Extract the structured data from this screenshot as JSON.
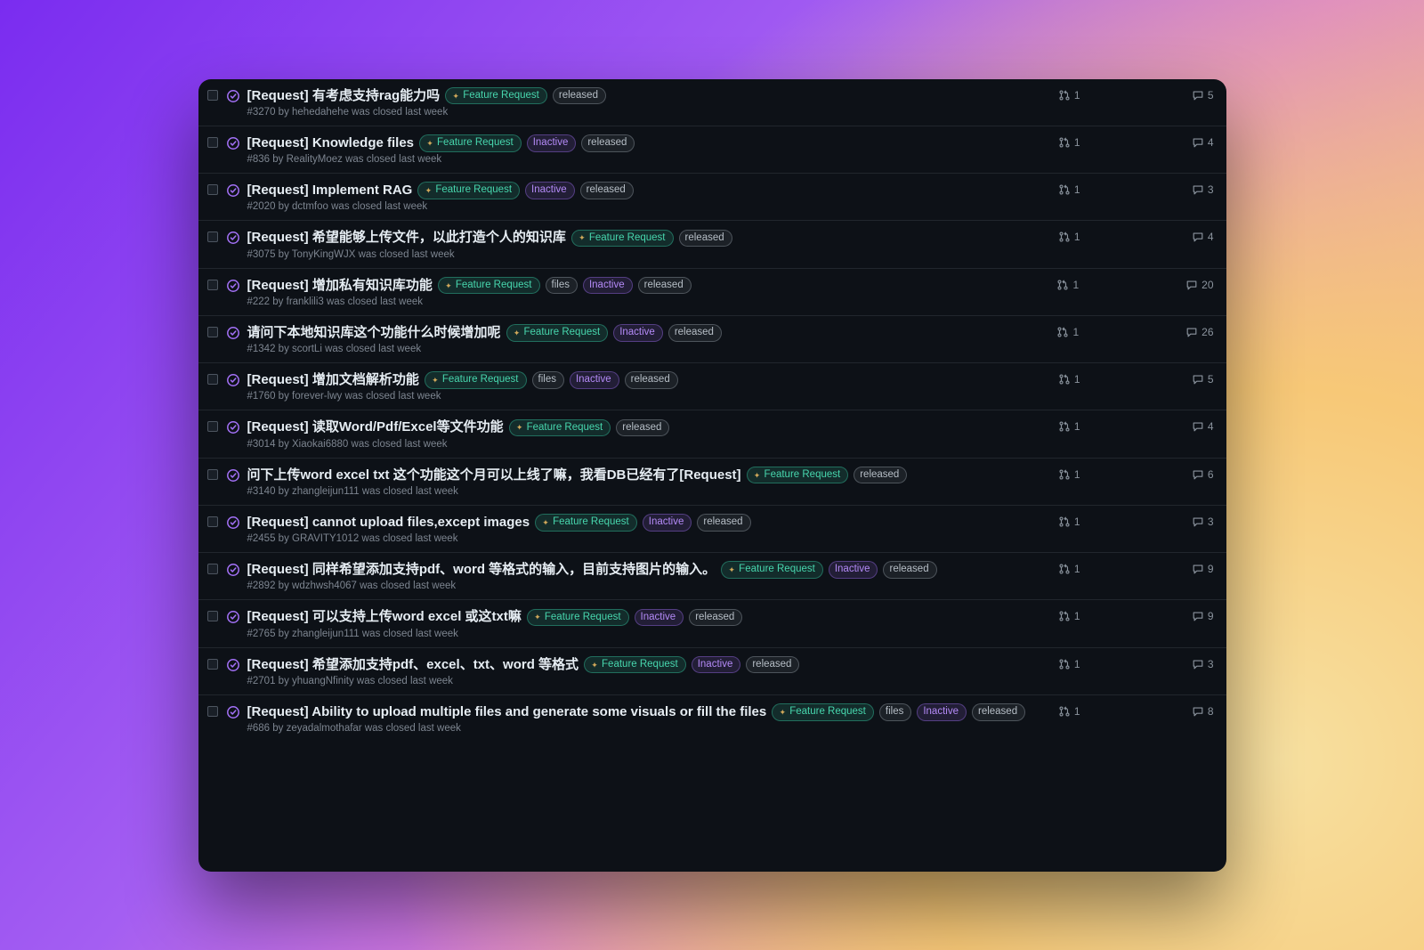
{
  "labels": {
    "feature": "Feature Request",
    "inactive": "Inactive",
    "released": "released",
    "files": "files"
  },
  "issues": [
    {
      "title": "[Request] 有考虑支持rag能力吗",
      "tags": [
        "feature",
        "released"
      ],
      "meta": "#3270 by hehedahehe was closed last week",
      "prs": 1,
      "comments": 5
    },
    {
      "title": "[Request] Knowledge files",
      "tags": [
        "feature",
        "inactive",
        "released"
      ],
      "meta": "#836 by RealityMoez was closed last week",
      "prs": 1,
      "comments": 4
    },
    {
      "title": "[Request] Implement RAG",
      "tags": [
        "feature",
        "inactive",
        "released"
      ],
      "meta": "#2020 by dctmfoo was closed last week",
      "prs": 1,
      "comments": 3
    },
    {
      "title": "[Request] 希望能够上传文件，以此打造个人的知识库",
      "tags": [
        "feature",
        "released"
      ],
      "meta": "#3075 by TonyKingWJX was closed last week",
      "prs": 1,
      "comments": 4
    },
    {
      "title": "[Request] 增加私有知识库功能",
      "tags": [
        "feature",
        "files",
        "inactive",
        "released"
      ],
      "meta": "#222 by franklili3 was closed last week",
      "prs": 1,
      "comments": 20
    },
    {
      "title": "请问下本地知识库这个功能什么时候增加呢",
      "tags": [
        "feature",
        "inactive",
        "released"
      ],
      "meta": "#1342 by scortLi was closed last week",
      "prs": 1,
      "comments": 26
    },
    {
      "title": "[Request] 增加文档解析功能",
      "tags": [
        "feature",
        "files",
        "inactive",
        "released"
      ],
      "meta": "#1760 by forever-lwy was closed last week",
      "prs": 1,
      "comments": 5
    },
    {
      "title": "[Request] 读取Word/Pdf/Excel等文件功能",
      "tags": [
        "feature",
        "released"
      ],
      "meta": "#3014 by Xiaokai6880 was closed last week",
      "prs": 1,
      "comments": 4
    },
    {
      "title": "问下上传word excel txt 这个功能这个月可以上线了嘛，我看DB已经有了[Request]",
      "tags": [
        "feature",
        "released"
      ],
      "meta": "#3140 by zhangleijun111 was closed last week",
      "prs": 1,
      "comments": 6
    },
    {
      "title": "[Request] cannot upload files,except images",
      "tags": [
        "feature",
        "inactive",
        "released"
      ],
      "meta": "#2455 by GRAVITY1012 was closed last week",
      "prs": 1,
      "comments": 3
    },
    {
      "title": "[Request] 同样希望添加支持pdf、word 等格式的输入，目前支持图片的输入。",
      "tags": [
        "feature",
        "inactive",
        "released"
      ],
      "meta": "#2892 by wdzhwsh4067 was closed last week",
      "prs": 1,
      "comments": 9
    },
    {
      "title": "[Request] 可以支持上传word excel 或这txt嘛",
      "tags": [
        "feature",
        "inactive",
        "released"
      ],
      "meta": "#2765 by zhangleijun111 was closed last week",
      "prs": 1,
      "comments": 9
    },
    {
      "title": "[Request] 希望添加支持pdf、excel、txt、word 等格式",
      "tags": [
        "feature",
        "inactive",
        "released"
      ],
      "meta": "#2701 by yhuangNfinity was closed last week",
      "prs": 1,
      "comments": 3
    },
    {
      "title": "[Request] Ability to upload multiple files and generate some visuals or fill the files",
      "tags": [
        "feature",
        "files",
        "inactive",
        "released"
      ],
      "meta": "#686 by zeyadalmothafar was closed last week",
      "prs": 1,
      "comments": 8
    }
  ]
}
